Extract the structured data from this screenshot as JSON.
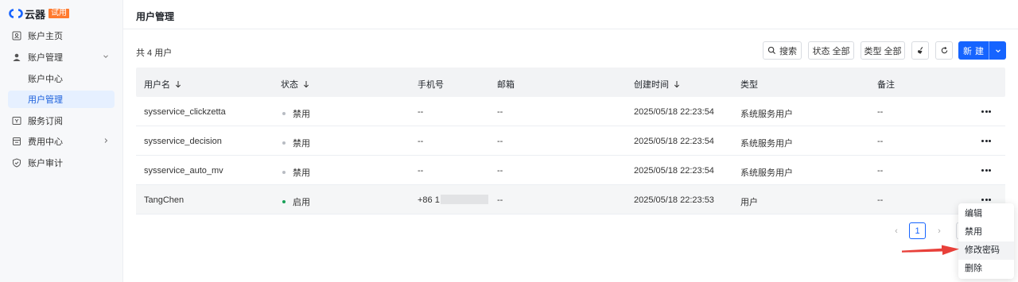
{
  "brand": {
    "name": "云器",
    "tag": "试用"
  },
  "sidebar": {
    "items": [
      {
        "label": "账户主页",
        "icon": "home-card-icon"
      },
      {
        "label": "账户管理",
        "icon": "user-icon",
        "expanded": true
      },
      {
        "label": "账户中心",
        "sub": true
      },
      {
        "label": "用户管理",
        "sub": true,
        "active": true
      },
      {
        "label": "服务订阅",
        "icon": "subscription-icon"
      },
      {
        "label": "费用中心",
        "icon": "billing-icon",
        "has_children": true
      },
      {
        "label": "账户审计",
        "icon": "shield-icon"
      }
    ]
  },
  "header": {
    "title": "用户管理"
  },
  "toolbar": {
    "count_text": "共 4 用户",
    "search_label": "搜索",
    "status_filter_label": "状态 全部",
    "type_filter_label": "类型 全部",
    "new_label": "新建"
  },
  "table": {
    "columns": [
      "用户名",
      "状态",
      "手机号",
      "邮箱",
      "创建时间",
      "类型",
      "备注"
    ],
    "rows": [
      {
        "username": "sysservice_clickzetta",
        "status": "禁用",
        "phone": "--",
        "email": "--",
        "created": "2025/05/18 22:23:54",
        "type": "系统服务用户",
        "note": "--"
      },
      {
        "username": "sysservice_decision",
        "status": "禁用",
        "phone": "--",
        "email": "--",
        "created": "2025/05/18 22:23:54",
        "type": "系统服务用户",
        "note": "--"
      },
      {
        "username": "sysservice_auto_mv",
        "status": "禁用",
        "phone": "--",
        "email": "--",
        "created": "2025/05/18 22:23:54",
        "type": "系统服务用户",
        "note": "--"
      },
      {
        "username": "TangChen",
        "status": "启用",
        "phone": "+86 1",
        "email": "--",
        "created": "2025/05/18 22:23:53",
        "type": "用户",
        "note": "--"
      }
    ]
  },
  "pagination": {
    "prev": "‹",
    "current": "1",
    "next": "›"
  },
  "menu": {
    "items": [
      "编辑",
      "禁用",
      "修改密码",
      "删除"
    ]
  },
  "colors": {
    "accent": "#1664ff",
    "enabled": "#18a058",
    "disabled": "#b8bcc3",
    "annotation": "#e8403a"
  }
}
